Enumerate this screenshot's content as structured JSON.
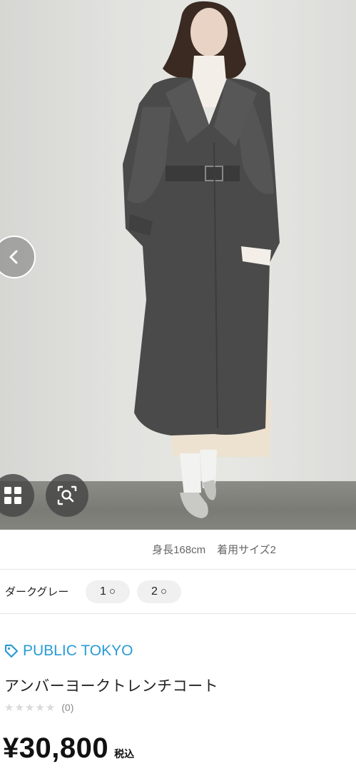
{
  "gallery": {
    "prev_icon": "chevron-left-icon",
    "grid_icon": "grid-icon",
    "zoom_icon": "zoom-search-icon"
  },
  "model_info": {
    "height": "身長168cm",
    "size_worn": "着用サイズ2"
  },
  "color": {
    "name": "ダークグレー",
    "sizes": [
      {
        "label": "1",
        "stock": "○"
      },
      {
        "label": "2",
        "stock": "○"
      }
    ]
  },
  "brand": {
    "icon": "tag-icon",
    "name": "PUBLIC TOKYO",
    "color": "#2a9bd6"
  },
  "product": {
    "name": "アンバーヨークトレンチコート",
    "stars": "★★★★★",
    "review_count": "(0)",
    "price": "¥30,800",
    "tax_label": "税込"
  }
}
